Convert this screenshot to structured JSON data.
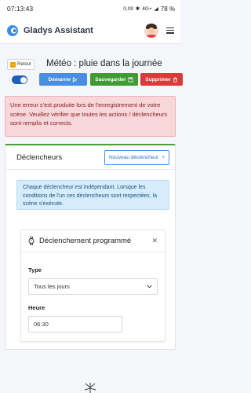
{
  "status_bar": {
    "time": "07:13:43",
    "network": "0,09",
    "signal": "4G+",
    "battery": "78 %"
  },
  "header": {
    "app_title": "Gladys Assistant"
  },
  "toolbar": {
    "back_label": "Retour",
    "scene_title": "Météo : pluie dans la journée",
    "start_label": "Démarrer",
    "save_label": "Sauvegarder",
    "delete_label": "Supprimer",
    "scene_enabled": true
  },
  "error": {
    "message": "Une erreur s'est produite lors de l'enregistrement de votre scène. Veuillez vérifier que toutes les actions / déclencheurs sont remplis et corrects."
  },
  "triggers": {
    "title": "Déclencheurs",
    "new_button_label": "Nouveau déclencheur",
    "info": "Chaque déclencheur est indépendant. Lorsque les conditions de l'un ces déclencheurs sont respectées, la scène s'exécute.",
    "items": [
      {
        "title": "Déclenchement programmé",
        "type_label": "Type",
        "type_value": "Tous les jours",
        "time_label": "Heure",
        "time_value": "06:30"
      }
    ]
  },
  "colors": {
    "primary": "#4a8ee0",
    "success": "#3f9b32",
    "danger": "#d93a3a",
    "error_bg": "#f8d7da",
    "info_bg": "#d6ecfa"
  }
}
